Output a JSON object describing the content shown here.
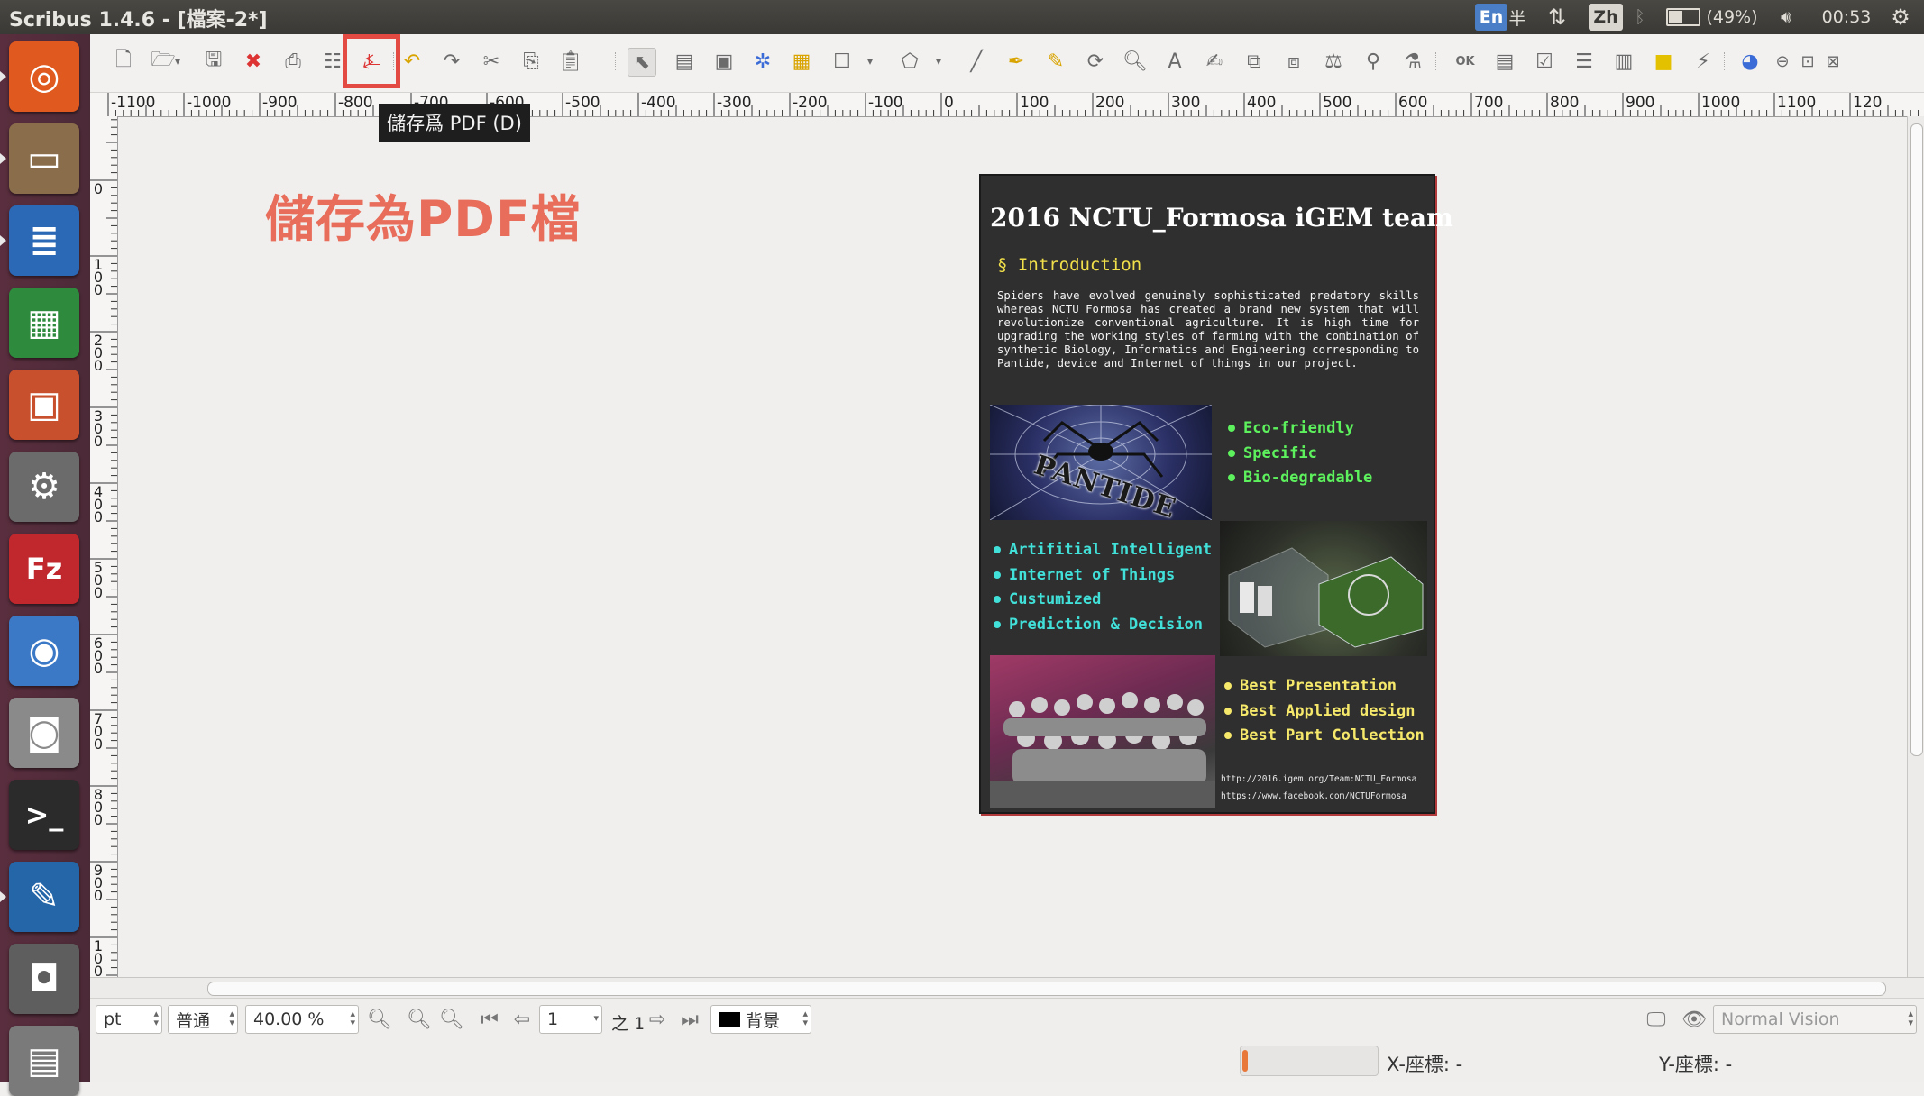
{
  "window": {
    "title": "Scribus 1.4.6 - [檔案-2*]"
  },
  "panel": {
    "input_method_en": "En",
    "half_width": "半",
    "input_method_zh": "Zh",
    "battery": "(49%)",
    "battery_level": 0.49,
    "time": "00:53"
  },
  "launcher": {
    "items": [
      {
        "name": "ubuntu-dash-icon",
        "glyph": "◎",
        "bg": "#e05a1f"
      },
      {
        "name": "files-icon",
        "glyph": "▭",
        "bg": "#8a6d4a"
      },
      {
        "name": "writer-icon",
        "glyph": "≣",
        "bg": "#2b68b5"
      },
      {
        "name": "calc-icon",
        "glyph": "▦",
        "bg": "#2e8b3d"
      },
      {
        "name": "impress-icon",
        "glyph": "▣",
        "bg": "#c8502d"
      },
      {
        "name": "system-settings-icon",
        "glyph": "⚙",
        "bg": "#6b6b6b"
      },
      {
        "name": "filezilla-icon",
        "glyph": "Fz",
        "bg": "#c0282d"
      },
      {
        "name": "chromium-icon",
        "glyph": "◉",
        "bg": "#3b79c7"
      },
      {
        "name": "camera-icon",
        "glyph": "◙",
        "bg": "#8a8a8a"
      },
      {
        "name": "terminal-icon",
        "glyph": ">_",
        "bg": "#2b2b2b"
      },
      {
        "name": "scribus-icon",
        "glyph": "✎",
        "bg": "#2466a8"
      },
      {
        "name": "screenshot-icon",
        "glyph": "◘",
        "bg": "#5e5e5e"
      },
      {
        "name": "trash-icon",
        "glyph": "▤",
        "bg": "#7a7a7a"
      }
    ]
  },
  "tooltip": {
    "text": "儲存爲 PDF (D)"
  },
  "annotation": {
    "text": "儲存為PDF檔"
  },
  "ruler": {
    "h_labels": [
      "-1100",
      "-1000",
      "-900",
      "-800",
      "-700",
      "-600",
      "-500",
      "-400",
      "-300",
      "-200",
      "-100",
      "0",
      "100",
      "200",
      "300",
      "400",
      "500",
      "600",
      "700",
      "800",
      "900",
      "1000",
      "1100",
      "120"
    ],
    "v_labels": [
      "0",
      "100",
      "200",
      "300",
      "400",
      "500",
      "600",
      "700",
      "800",
      "900",
      "1000"
    ]
  },
  "poster": {
    "title": "2016 NCTU_Formosa iGEM team",
    "section": "§ Introduction",
    "intro": "Spiders have evolved genuinely sophisticated predatory skills whereas NCTU_Formosa has created a brand new system that will revolutionize conventional agriculture. It is high time for upgrading the working styles of farming with the combination of synthetic Biology, Informatics and Engineering corresponding to Pantide, device and Internet of things in our project.",
    "spider_logo": "PANTIDE",
    "features": [
      "Eco-friendly",
      "Specific",
      "Bio-degradable"
    ],
    "tech": [
      "Artifitial Intelligent",
      "Internet of Things",
      "Custumized",
      "Prediction & Decision"
    ],
    "awards": [
      "Best Presentation",
      "Best Applied design",
      "Best Part Collection"
    ],
    "url1": "http://2016.igem.org/Team:NCTU_Formosa",
    "url2": "https://www.facebook.com/NCTUFormosa"
  },
  "bottom": {
    "unit": "pt",
    "mode": "普通",
    "zoom": "40.00 %",
    "page": "1",
    "page_of": "之 1",
    "layer": "背景",
    "vision": "Normal Vision"
  },
  "status": {
    "x_label": "X-座標: -",
    "y_label": "Y-座標: -",
    "progress": 0.03
  }
}
